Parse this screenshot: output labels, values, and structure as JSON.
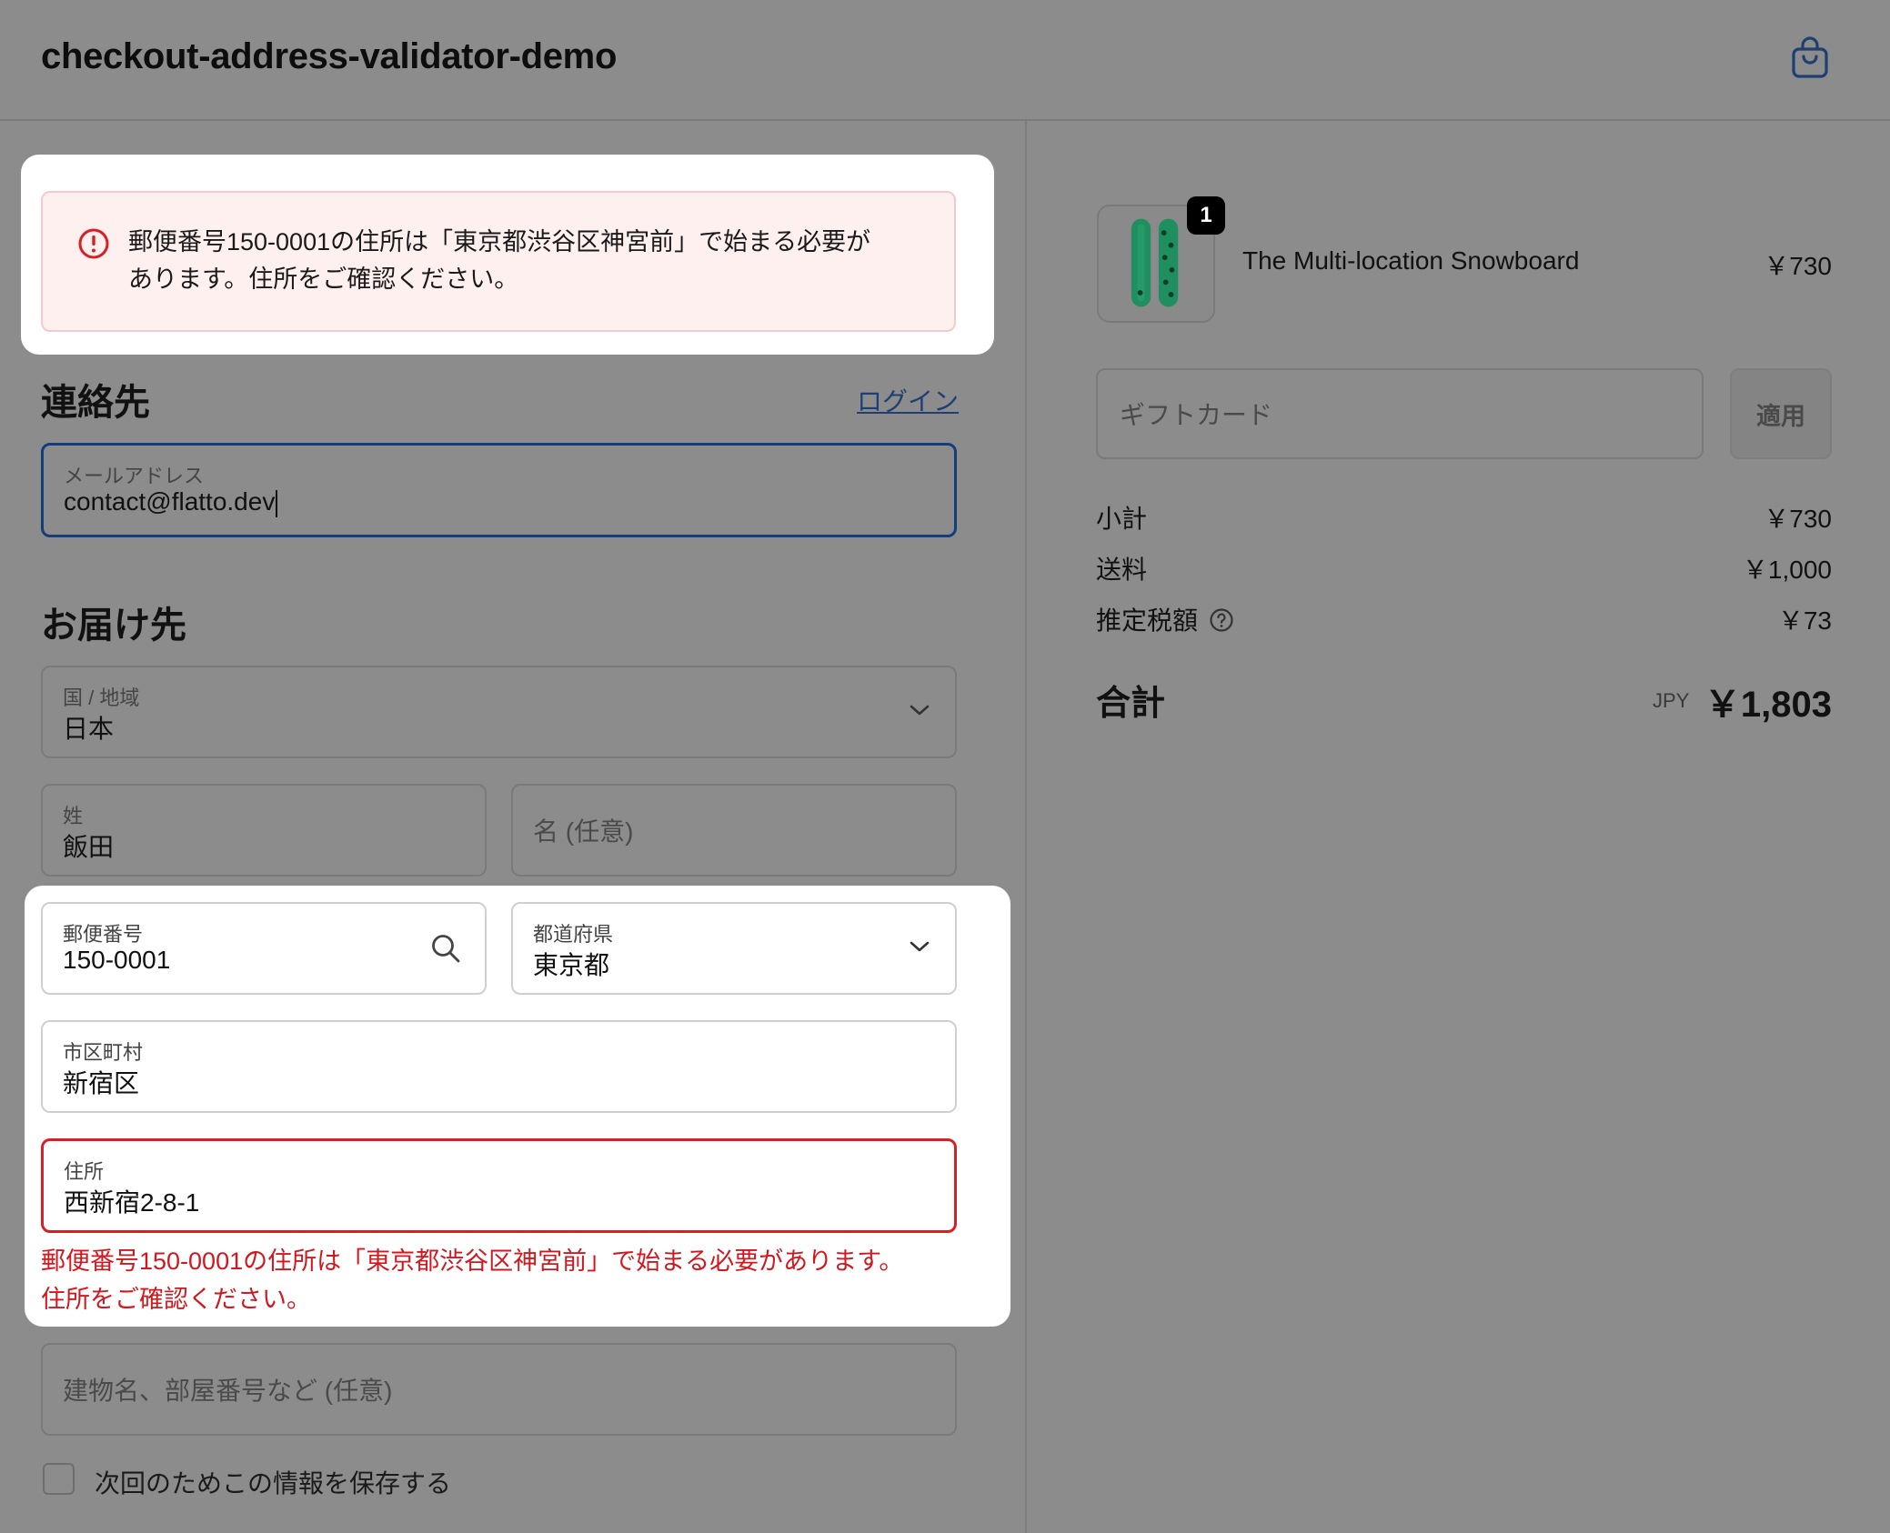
{
  "header": {
    "title": "checkout-address-validator-demo",
    "cart_icon": "shopping-bag-icon"
  },
  "error_banner": {
    "icon": "alert-circle-icon",
    "line1": "郵便番号150-0001の住所は「東京都渋谷区神宮前」で始まる必要が",
    "line2": "あります。住所をご確認ください。"
  },
  "contact": {
    "title": "連絡先",
    "login_label": "ログイン",
    "email": {
      "label": "メールアドレス",
      "value": "contact@flatto.dev"
    }
  },
  "delivery": {
    "title": "お届け先",
    "country": {
      "label": "国 / 地域",
      "value": "日本"
    },
    "last_name": {
      "label": "姓",
      "value": "飯田"
    },
    "first_name": {
      "placeholder": "名 (任意)"
    },
    "postal_code": {
      "label": "郵便番号",
      "value": "150-0001"
    },
    "prefecture": {
      "label": "都道府県",
      "value": "東京都"
    },
    "city": {
      "label": "市区町村",
      "value": "新宿区"
    },
    "address": {
      "label": "住所",
      "value": "西新宿2-8-1"
    },
    "address_error": {
      "line1": "郵便番号150-0001の住所は「東京都渋谷区神宮前」で始まる必要があります。",
      "line2": "住所をご確認ください。"
    },
    "building": {
      "placeholder": "建物名、部屋番号など (任意)"
    },
    "save_info_label": "次回のためこの情報を保存する"
  },
  "summary": {
    "product": {
      "quantity": "1",
      "name": "The Multi-location Snowboard",
      "price": "￥730"
    },
    "gift_card": {
      "placeholder": "ギフトカード",
      "apply_label": "適用"
    },
    "rows": [
      {
        "label": "小計",
        "value": "￥730"
      },
      {
        "label": "送料",
        "value": "￥1,000"
      },
      {
        "label": "推定税額",
        "value": "￥73"
      }
    ],
    "total": {
      "label": "合計",
      "currency": "JPY",
      "value": "￥1,803"
    }
  },
  "colors": {
    "overlay_bg": "#8c8c8c",
    "error_red": "#d91f26",
    "focus_blue": "#153d7a",
    "link_blue": "#1f3f73"
  }
}
